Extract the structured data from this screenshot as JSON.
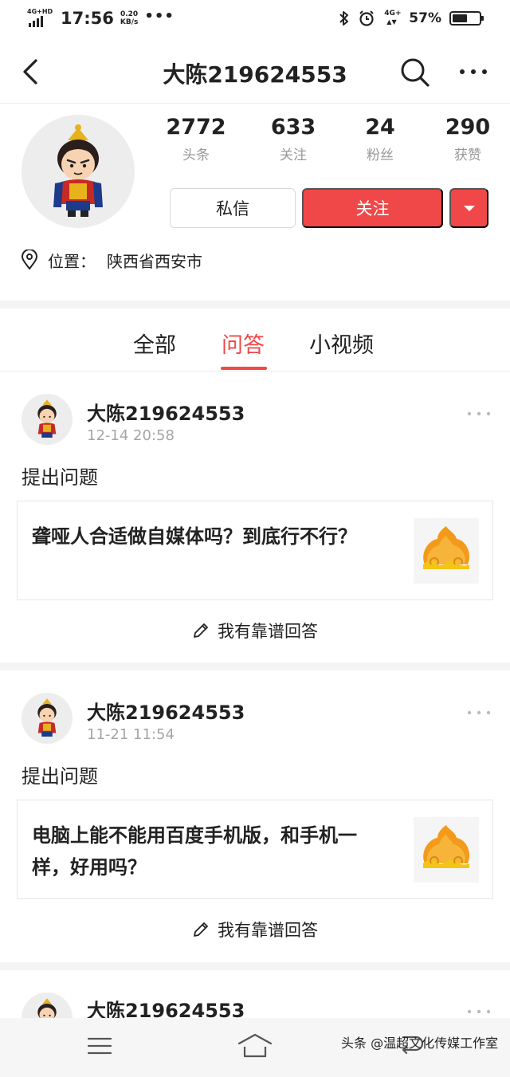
{
  "status_bar": {
    "network": "4G+HD",
    "time": "17:56",
    "speed_value": "0.20",
    "speed_unit": "KB/s",
    "network_right": "4G+",
    "battery": "57%",
    "battery_level": 0.57
  },
  "header": {
    "title": "大陈219624553",
    "back_icon": "chevron-left-icon",
    "search_icon": "search-icon",
    "more_icon": "more-horizontal-icon"
  },
  "profile": {
    "stats": [
      {
        "value": "2772",
        "label": "头条"
      },
      {
        "value": "633",
        "label": "关注"
      },
      {
        "value": "24",
        "label": "粉丝"
      },
      {
        "value": "290",
        "label": "获赞"
      }
    ],
    "message_label": "私信",
    "follow_label": "关注",
    "location_key": "位置：",
    "location_value": "陕西省西安市"
  },
  "tabs": [
    {
      "label": "全部",
      "active": false
    },
    {
      "label": "问答",
      "active": true
    },
    {
      "label": "小视频",
      "active": false
    }
  ],
  "feed": [
    {
      "author": "大陈219624553",
      "date": "12-14 20:58",
      "action": "提出问题",
      "question": "聋哑人合适做自媒体吗？到底行不行？",
      "answer_label": "我有靠谱回答"
    },
    {
      "author": "大陈219624553",
      "date": "11-21 11:54",
      "action": "提出问题",
      "question": "电脑上能不能用百度手机版，和手机一样，好用吗？",
      "answer_label": "我有靠谱回答"
    },
    {
      "author": "大陈219624553"
    }
  ],
  "nav": {
    "watermark": "头条 @温超文化传媒工作室"
  },
  "colors": {
    "accent": "#f04848",
    "muted_text": "#999999"
  }
}
